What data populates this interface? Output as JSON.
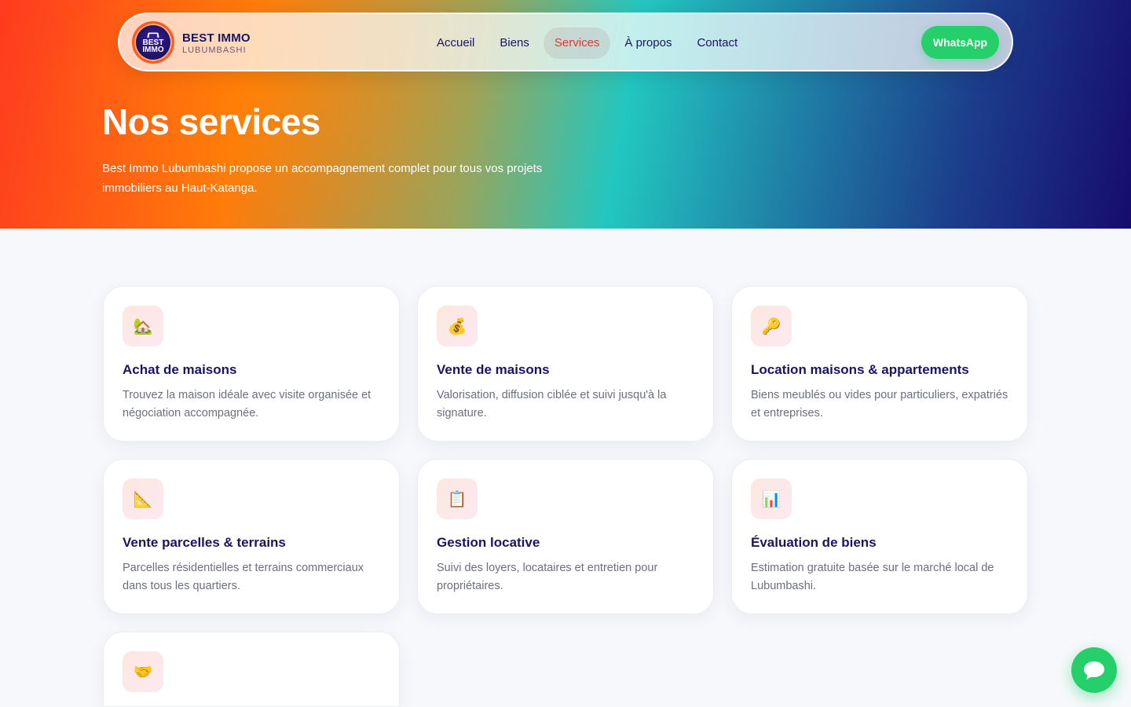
{
  "brand": {
    "name": "BEST IMMO",
    "subtitle": "LUBUMBASHI",
    "logo_text_1": "BEST",
    "logo_text_2": "IMMO"
  },
  "nav": {
    "items": [
      "Accueil",
      "Biens",
      "Services",
      "À propos",
      "Contact"
    ],
    "active": "Services"
  },
  "whatsapp_button": "WhatsApp",
  "hero": {
    "title": "Nos services",
    "text": "Best Immo Lubumbashi propose un accompagnement complet pour tous vos projets immobiliers au Haut-Katanga."
  },
  "services": [
    {
      "icon": "house-icon",
      "glyph": "🏡",
      "title": "Achat de maisons",
      "desc": "Trouvez la maison idéale avec visite organisée et négociation accompagnée."
    },
    {
      "icon": "money-bag-icon",
      "glyph": "💰",
      "title": "Vente de maisons",
      "desc": "Valorisation, diffusion ciblée et suivi jusqu'à la signature."
    },
    {
      "icon": "key-icon",
      "glyph": "🔑",
      "title": "Location maisons & appartements",
      "desc": "Biens meublés ou vides pour particuliers, expatriés et entreprises."
    },
    {
      "icon": "triangle-ruler-icon",
      "glyph": "📐",
      "title": "Vente parcelles & terrains",
      "desc": "Parcelles résidentielles et terrains commerciaux dans tous les quartiers."
    },
    {
      "icon": "clipboard-icon",
      "glyph": "📋",
      "title": "Gestion locative",
      "desc": "Suivi des loyers, locataires et entretien pour propriétaires."
    },
    {
      "icon": "bar-chart-icon",
      "glyph": "📊",
      "title": "Évaluation de biens",
      "desc": "Estimation gratuite basée sur le marché local de Lubumbashi."
    },
    {
      "icon": "handshake-icon",
      "glyph": "🤝",
      "title": "",
      "desc": ""
    }
  ],
  "colors": {
    "accent": "#e8362a",
    "whatsapp": "#25d06a",
    "navy": "#1b1464"
  }
}
